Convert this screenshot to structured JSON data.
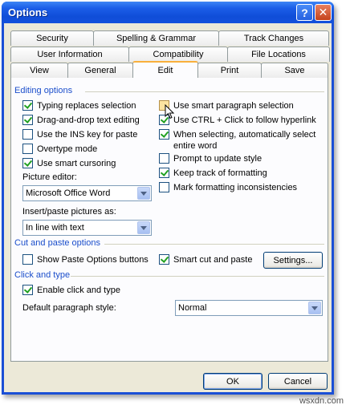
{
  "window": {
    "title": "Options"
  },
  "tabs": {
    "row1": [
      "Security",
      "Spelling & Grammar",
      "Track Changes"
    ],
    "row2": [
      "User Information",
      "Compatibility",
      "File Locations"
    ],
    "row3": [
      "View",
      "General",
      "Edit",
      "Print",
      "Save"
    ],
    "active": "Edit"
  },
  "editing": {
    "title": "Editing options",
    "typing_replaces": "Typing replaces selection",
    "drag_drop": "Drag-and-drop text editing",
    "ins_key": "Use the INS key for paste",
    "overtype": "Overtype mode",
    "smart_cursoring": "Use smart cursoring",
    "picture_editor_label": "Picture editor:",
    "picture_editor_value": "Microsoft Office Word",
    "insert_paste_label": "Insert/paste pictures as:",
    "insert_paste_value": "In line with text",
    "smart_paragraph": "Use smart paragraph selection",
    "ctrl_click": "Use CTRL + Click to follow hyperlink",
    "auto_select_word": "When selecting, automatically select entire word",
    "prompt_style": "Prompt to update style",
    "keep_track": "Keep track of formatting",
    "mark_inconsistencies": "Mark formatting inconsistencies"
  },
  "cut_paste": {
    "title": "Cut and paste options",
    "show_paste_buttons": "Show Paste Options buttons",
    "smart_cut": "Smart cut and paste",
    "settings_button": "Settings..."
  },
  "click_type": {
    "title": "Click and type",
    "enable": "Enable click and type",
    "default_style_label": "Default paragraph style:",
    "default_style_value": "Normal"
  },
  "buttons": {
    "ok": "OK",
    "cancel": "Cancel"
  },
  "watermark": "wsxdn.com"
}
